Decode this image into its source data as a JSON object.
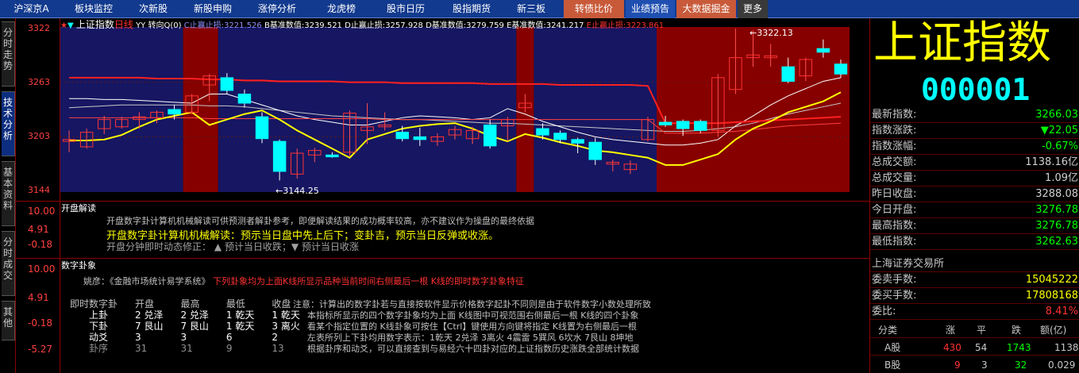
{
  "nav": {
    "tabs": [
      "沪深京A",
      "板块监控",
      "次新股",
      "新股申购",
      "涨停分析",
      "龙虎榜",
      "股市日历",
      "股指期货",
      "新三板",
      "转债比价",
      "业绩预告",
      "大数据掘金",
      "更多"
    ]
  },
  "side_tabs": [
    "分时走势",
    "技术分析",
    "基本资料",
    "分时成交",
    "其他"
  ],
  "chart_header": {
    "name": "上证指数",
    "period": "日线",
    "params": "YY 转向Q(0)",
    "c_label": "C止赢止损:",
    "c_val": "3221.526",
    "b_label": "B基准数值:",
    "b_val": "3239.521",
    "d_label": "D止赢止损:",
    "d_val": "3257.928",
    "d2_label": "D基准数值:",
    "d2_val": "3279.759",
    "e_label": "E基准数值:",
    "e_val": "3241.217",
    "e2_label": "E止赢止损:",
    "e2_val": "3223.861"
  },
  "main_axis": [
    "3322",
    "3263",
    "3203",
    "3144"
  ],
  "annotations": {
    "high": "3322.13",
    "low": "3144.25"
  },
  "colors": {
    "up": "#ff3232",
    "down": "#00ffff",
    "gold": "#ffff00",
    "white": "#ffffff",
    "red_band": "#b40000",
    "blue_band": "#1c1c7a"
  },
  "candles": [
    {
      "o": 3198,
      "h": 3210,
      "l": 3186,
      "c": 3200
    },
    {
      "o": 3192,
      "h": 3212,
      "l": 3190,
      "c": 3208
    },
    {
      "o": 3212,
      "h": 3226,
      "l": 3206,
      "c": 3222
    },
    {
      "o": 3214,
      "h": 3225,
      "l": 3212,
      "c": 3222
    },
    {
      "o": 3222,
      "h": 3230,
      "l": 3212,
      "c": 3225
    },
    {
      "o": 3224,
      "h": 3232,
      "l": 3218,
      "c": 3230
    },
    {
      "o": 3233,
      "h": 3238,
      "l": 3222,
      "c": 3228
    },
    {
      "o": 3230,
      "h": 3250,
      "l": 3228,
      "c": 3248
    },
    {
      "o": 3260,
      "h": 3272,
      "l": 3242,
      "c": 3270
    },
    {
      "o": 3268,
      "h": 3273,
      "l": 3250,
      "c": 3254
    },
    {
      "o": 3250,
      "h": 3255,
      "l": 3235,
      "c": 3240
    },
    {
      "o": 3225,
      "h": 3230,
      "l": 3196,
      "c": 3201
    },
    {
      "o": 3198,
      "h": 3200,
      "l": 3155,
      "c": 3165
    },
    {
      "o": 3162,
      "h": 3190,
      "l": 3157,
      "c": 3185
    },
    {
      "o": 3183,
      "h": 3191,
      "l": 3175,
      "c": 3188
    },
    {
      "o": 3183,
      "h": 3186,
      "l": 3180,
      "c": 3181
    },
    {
      "o": 3186,
      "h": 3232,
      "l": 3182,
      "c": 3229
    },
    {
      "o": 3210,
      "h": 3240,
      "l": 3195,
      "c": 3214
    },
    {
      "o": 3214,
      "h": 3230,
      "l": 3210,
      "c": 3216
    },
    {
      "o": 3208,
      "h": 3215,
      "l": 3198,
      "c": 3201
    },
    {
      "o": 3203,
      "h": 3213,
      "l": 3193,
      "c": 3200
    },
    {
      "o": 3198,
      "h": 3207,
      "l": 3193,
      "c": 3203
    },
    {
      "o": 3205,
      "h": 3215,
      "l": 3200,
      "c": 3211
    },
    {
      "o": 3201,
      "h": 3214,
      "l": 3195,
      "c": 3210
    },
    {
      "o": 3216,
      "h": 3222,
      "l": 3190,
      "c": 3193
    },
    {
      "o": 3215,
      "h": 3225,
      "l": 3198,
      "c": 3222
    },
    {
      "o": 3235,
      "h": 3250,
      "l": 3230,
      "c": 3240
    },
    {
      "o": 3212,
      "h": 3218,
      "l": 3200,
      "c": 3205
    },
    {
      "o": 3207,
      "h": 3210,
      "l": 3196,
      "c": 3200
    },
    {
      "o": 3200,
      "h": 3202,
      "l": 3185,
      "c": 3196
    },
    {
      "o": 3197,
      "h": 3202,
      "l": 3172,
      "c": 3178
    },
    {
      "o": 3173,
      "h": 3178,
      "l": 3165,
      "c": 3175
    },
    {
      "o": 3167,
      "h": 3177,
      "l": 3162,
      "c": 3173
    },
    {
      "o": 3200,
      "h": 3225,
      "l": 3198,
      "c": 3222
    },
    {
      "o": 3219,
      "h": 3226,
      "l": 3214,
      "c": 3216
    },
    {
      "o": 3220,
      "h": 3222,
      "l": 3204,
      "c": 3212
    },
    {
      "o": 3220,
      "h": 3222,
      "l": 3207,
      "c": 3210
    },
    {
      "o": 3210,
      "h": 3272,
      "l": 3203,
      "c": 3268
    },
    {
      "o": 3255,
      "h": 3322,
      "l": 3250,
      "c": 3290
    },
    {
      "o": 3290,
      "h": 3320,
      "l": 3280,
      "c": 3293
    },
    {
      "o": 3290,
      "h": 3305,
      "l": 3280,
      "c": 3292
    },
    {
      "o": 3280,
      "h": 3290,
      "l": 3262,
      "c": 3264
    },
    {
      "o": 3270,
      "h": 3290,
      "l": 3264,
      "c": 3288
    },
    {
      "o": 3300,
      "h": 3310,
      "l": 3290,
      "c": 3296
    },
    {
      "o": 3283,
      "h": 3288,
      "l": 3268,
      "c": 3272
    }
  ],
  "bands": [
    {
      "from": 0,
      "to": 6,
      "kind": "blue"
    },
    {
      "from": 7,
      "to": 8,
      "kind": "red"
    },
    {
      "from": 9,
      "to": 25,
      "kind": "blue"
    },
    {
      "from": 26,
      "to": 26,
      "kind": "red"
    },
    {
      "from": 27,
      "to": 33,
      "kind": "blue"
    },
    {
      "from": 34,
      "to": 44,
      "kind": "red"
    }
  ],
  "lines": {
    "red": [
      3268,
      3268,
      3268,
      3268,
      3268,
      3267,
      3267,
      3267,
      3266,
      3266,
      3265,
      3265,
      3264,
      3264,
      3264,
      3264,
      3263,
      3263,
      3263,
      3262,
      3262,
      3262,
      3262,
      3262,
      3261,
      3261,
      3261,
      3261,
      3260,
      3260,
      3260,
      3260,
      3260,
      3259,
      3218,
      3218,
      3218,
      3218,
      3219,
      3220,
      3221,
      3222,
      3223,
      3224,
      3225
    ],
    "yellow": [
      3199,
      3199,
      3200,
      3205,
      3214,
      3222,
      3226,
      3230,
      3216,
      3222,
      3228,
      3232,
      3222,
      3210,
      3200,
      3190,
      3180,
      3200,
      3206,
      3212,
      3215,
      3217,
      3218,
      3212,
      3204,
      3198,
      3206,
      3202,
      3197,
      3193,
      3188,
      3186,
      3183,
      3180,
      3172,
      3172,
      3178,
      3184,
      3200,
      3212,
      3220,
      3230,
      3236,
      3242,
      3252
    ],
    "white1": [
      3245,
      3245,
      3244,
      3244,
      3243,
      3242,
      3241,
      3240,
      3250,
      3250,
      3244,
      3238,
      3232,
      3226,
      3222,
      3219,
      3216,
      3216,
      3220,
      3224,
      3226,
      3225,
      3224,
      3222,
      3224,
      3234,
      3228,
      3220,
      3214,
      3208,
      3203,
      3200,
      3198,
      3196,
      3194,
      3194,
      3196,
      3200,
      3215,
      3226,
      3238,
      3248,
      3256,
      3264,
      3268
    ],
    "white2": [
      3235,
      3236,
      3237,
      3238,
      3238,
      3238,
      3238,
      3238,
      3237,
      3237,
      3236,
      3234,
      3232,
      3230,
      3228,
      3226,
      3225,
      3224,
      3223,
      3222,
      3222,
      3221,
      3220,
      3219,
      3218,
      3218,
      3217,
      3216,
      3215,
      3214,
      3213,
      3212,
      3211,
      3210,
      3209,
      3209,
      3210,
      3212,
      3214,
      3218,
      3223,
      3228,
      3232,
      3236,
      3240
    ],
    "red2": [
      3224,
      3224,
      3224,
      3224,
      3224,
      3224,
      3224,
      3224,
      3223,
      3223,
      3223,
      3223,
      3223,
      3223,
      3223,
      3223,
      3223,
      3223,
      3222,
      3222,
      3222,
      3222,
      3222,
      3222,
      3222,
      3222,
      3222,
      3222,
      3222,
      3222,
      3222,
      3222,
      3222,
      3222,
      3207,
      3207,
      3207,
      3208,
      3209,
      3211,
      3213,
      3215,
      3216,
      3217,
      3218
    ]
  },
  "open_panel": {
    "axis": [
      "10.00",
      "4.91",
      "-0.18",
      "-5.27"
    ],
    "title": "开盘解读",
    "line1": "开盘数字卦计算机机械解读可供预测者解卦参考，即便解读结果的成功概率较高，亦不建议作为操盘的最终依据",
    "line2": "开盘数字卦计算机机械解读：预示当日盘中先上后下；变卦吉，预示当日反弹或收涨。",
    "line3": "开盘分钟即时动态修正：  ▲ 预计当日收跌；▼ 预计当日收涨"
  },
  "gua_panel": {
    "axis": [
      "10.00",
      "4.91",
      "-0.18",
      "-5.27"
    ],
    "title": "数字卦象",
    "yao_prefix": "姚彦：《金融市场统计易学系统》",
    "yao_red": "下列卦象均为上面K线所显示品种当前时间右侧最后一根 K线的即时数字卦象特征",
    "table_header": [
      "即时数字卦",
      "开盘",
      "最高",
      "最低",
      "收盘"
    ],
    "rows": [
      [
        "上卦",
        "2 兑泽",
        "2 兑泽",
        "1 乾天",
        "1 乾天"
      ],
      [
        "下卦",
        "7 艮山",
        "7 艮山",
        "1 乾天",
        "3 离火"
      ],
      [
        "动爻",
        "3",
        "3",
        "6",
        "2"
      ],
      [
        "卦序",
        "31",
        "31",
        "9",
        "13"
      ]
    ],
    "note_lines": [
      "注意：计算出的数字卦若与直接按软件显示价格数字起卦不同则是由于软件数字小数处理所致",
      "本指标所显示的四个数字卦象均为上面 K线图中可视范围右侧最后一根 K线的四个卦象",
      "看某个指定位置的 K线卦象可按住【Ctrl】键使用方向键将指定 K线置为右侧最后一根",
      "左表所列上下卦均用数字表示：1乾天 2兑泽 3离火 4震雷 5巽风 6坎水 7艮山 8坤地",
      "根据卦序和动爻，可以直接查到与易经六十四卦对应的上证指数历史涨跌全部统计数据"
    ]
  },
  "right": {
    "title": "上证指数",
    "code": "000001",
    "rows": [
      {
        "label": "最新指数:",
        "value": "3266.03",
        "color": "#00ff00"
      },
      {
        "label": "指数涨跌:",
        "value": "▼22.05",
        "color": "#00ff00"
      },
      {
        "label": "指数涨幅:",
        "value": "-0.67%",
        "color": "#00ff00"
      },
      {
        "label": "总成交额:",
        "value": "1138.16亿",
        "color": "#d0d0d0"
      },
      {
        "label": "总成交量:",
        "value": "1.09亿",
        "color": "#d0d0d0"
      },
      {
        "label": "昨日收盘:",
        "value": "3288.08",
        "color": "#d0d0d0"
      },
      {
        "label": "今日开盘:",
        "value": "3276.78",
        "color": "#00ff00"
      },
      {
        "label": "最高指数:",
        "value": "3276.78",
        "color": "#00ff00"
      },
      {
        "label": "最低指数:",
        "value": "3262.63",
        "color": "#00ff00"
      }
    ],
    "exchange": "上海证券交易所",
    "rows2": [
      {
        "label": "委卖手数:",
        "value": "15045222",
        "color": "#ffff00"
      },
      {
        "label": "委买手数:",
        "value": "17808168",
        "color": "#ffff00"
      },
      {
        "label": "委比:",
        "value": "8.41%",
        "color": "#ff3232"
      }
    ],
    "table_header": [
      "分类",
      "涨",
      "平",
      "跌",
      "额(亿)"
    ],
    "table_rows": [
      [
        "A股",
        "430",
        "54",
        "1743",
        "1138"
      ],
      [
        "B股",
        "9",
        "3",
        "32",
        "0.029"
      ]
    ]
  }
}
